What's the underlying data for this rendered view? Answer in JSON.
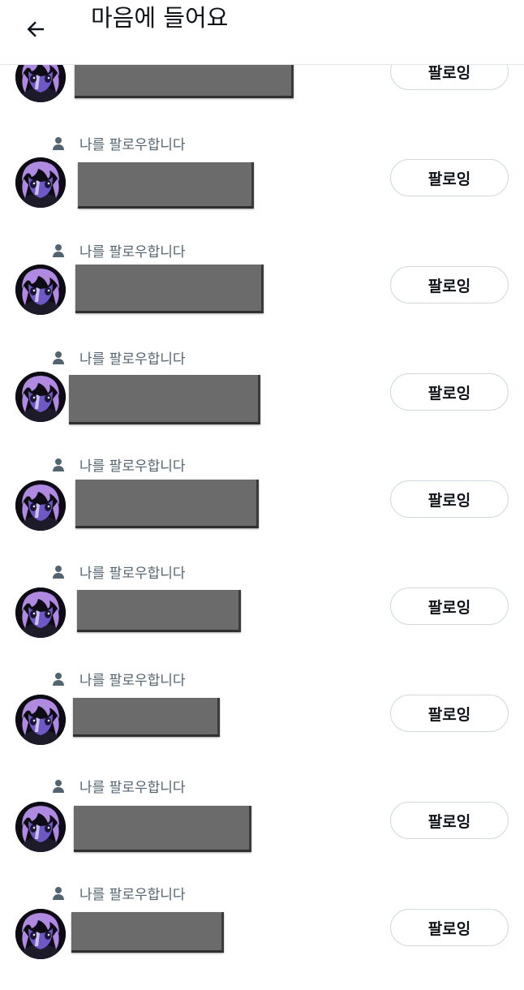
{
  "header": {
    "title": "마음에 들어요",
    "back_icon": "arrow-left-icon"
  },
  "rows": [
    {
      "follows_you": "",
      "button": "팔로잉",
      "avatar_icon": "purple-hair-character-avatar"
    },
    {
      "follows_you": "나를 팔로우합니다",
      "button": "팔로잉",
      "avatar_icon": "purple-hair-character-avatar"
    },
    {
      "follows_you": "나를 팔로우합니다",
      "button": "팔로잉",
      "avatar_icon": "purple-hair-character-avatar"
    },
    {
      "follows_you": "나를 팔로우합니다",
      "button": "팔로잉",
      "avatar_icon": "purple-hair-character-avatar"
    },
    {
      "follows_you": "나를 팔로우합니다",
      "button": "팔로잉",
      "avatar_icon": "purple-hair-character-avatar"
    },
    {
      "follows_you": "나를 팔로우합니다",
      "button": "팔로잉",
      "avatar_icon": "purple-hair-character-avatar"
    },
    {
      "follows_you": "나를 팔로우합니다",
      "button": "팔로잉",
      "avatar_icon": "purple-hair-character-avatar"
    },
    {
      "follows_you": "나를 팔로우합니다",
      "button": "팔로잉",
      "avatar_icon": "purple-hair-character-avatar"
    },
    {
      "follows_you": "나를 팔로우합니다",
      "button": "팔로잉",
      "avatar_icon": "purple-hair-character-avatar"
    }
  ],
  "colors": {
    "redaction": "#6b6b6b",
    "secondary_text": "#536471",
    "button_border": "#cfd9de",
    "avatar_hair": "#b08ae0"
  }
}
